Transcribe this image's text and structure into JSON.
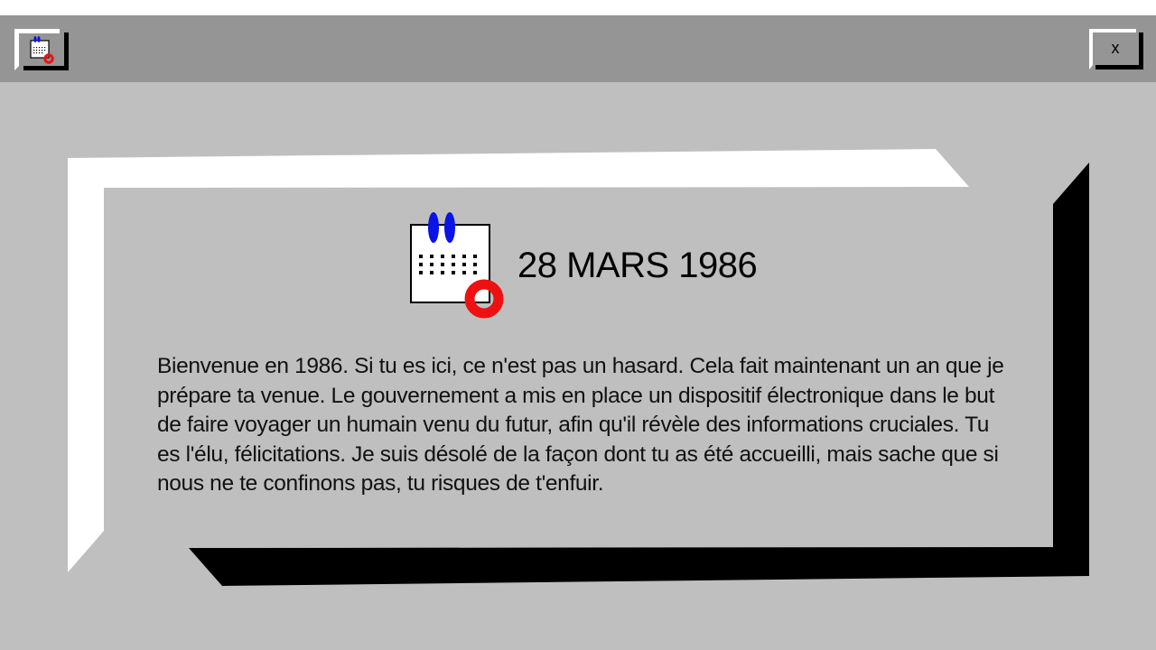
{
  "window": {
    "app_icon": "calendar-icon",
    "close_label": "x"
  },
  "dialog": {
    "date": "28 MARS 1986",
    "icon": "calendar-icon",
    "message": "Bienvenue en 1986. Si tu es ici, ce n'est pas un hasard. Cela fait maintenant un an que je prépare ta venue. Le gouvernement a mis en place un dispositif électronique dans le but de faire voyager un humain venu du futur, afin qu'il révèle des informations cruciales. Tu es l'élu, félicitations. Je suis désolé de la façon dont tu as été accueilli, mais sache que si nous ne te confinons pas, tu risques de t'enfuir."
  },
  "colors": {
    "background": "#bfbfbf",
    "titlebar": "#959595",
    "accent_blue": "#0a14e6",
    "accent_red": "#ee1111"
  }
}
